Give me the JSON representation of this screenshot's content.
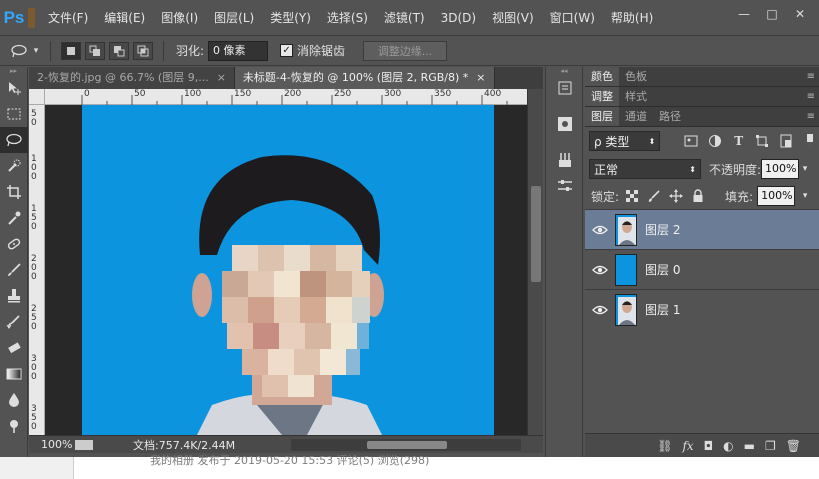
{
  "app": {
    "logo": "Ps",
    "menu": [
      "文件(F)",
      "编辑(E)",
      "图像(I)",
      "图层(L)",
      "类型(Y)",
      "选择(S)",
      "滤镜(T)",
      "3D(D)",
      "视图(V)",
      "窗口(W)",
      "帮助(H)"
    ],
    "window_controls": [
      "—",
      "□",
      "✕"
    ]
  },
  "options": {
    "feather_label": "羽化:",
    "feather_value": "0 像素",
    "antialias_label": "消除锯齿",
    "refine_label": "调整边缘..."
  },
  "tabs": [
    {
      "label": "2-恢复的.jpg @ 66.7% (图层 9,...",
      "close": "×"
    },
    {
      "label": "未标题-4-恢复的 @ 100% (图层 2, RGB/8) *",
      "close": "×"
    }
  ],
  "ruler": {
    "h_ticks": [
      "0",
      "50",
      "100",
      "150",
      "200",
      "250",
      "300",
      "350",
      "400"
    ],
    "v_ticks": [
      "5\n0",
      "1\n0\n0",
      "1\n5\n0",
      "2\n0\n0",
      "2\n5\n0",
      "3\n0\n0",
      "3\n5\n0"
    ]
  },
  "status": {
    "zoom": "100%",
    "doc_info": "文档:757.4K/2.44M"
  },
  "panels": {
    "top_tabs": [
      "颜色",
      "色板"
    ],
    "adjust_tabs": [
      "调整",
      "样式"
    ],
    "layer_tabs": [
      "图层",
      "通道",
      "路径"
    ],
    "filter_kind": "ρ 类型",
    "blend_mode": "正常",
    "opacity_label": "不透明度:",
    "opacity_value": "100%",
    "lock_label": "锁定:",
    "fill_label": "填充:",
    "fill_value": "100%"
  },
  "layers": [
    {
      "name": "图层 2",
      "selected": true,
      "thumb": "photo"
    },
    {
      "name": "图层 0",
      "selected": false,
      "thumb": "blue"
    },
    {
      "name": "图层 1",
      "selected": false,
      "thumb": "photo"
    }
  ],
  "colors": {
    "background_blue": "#0c94de",
    "selection_highlight": "#6b7d96",
    "ps_blue": "#31a8ff"
  },
  "bottom_strip": {
    "text": "我的相册  发布于 2019-05-20 15:53   评论(5)   浏览(298)"
  }
}
